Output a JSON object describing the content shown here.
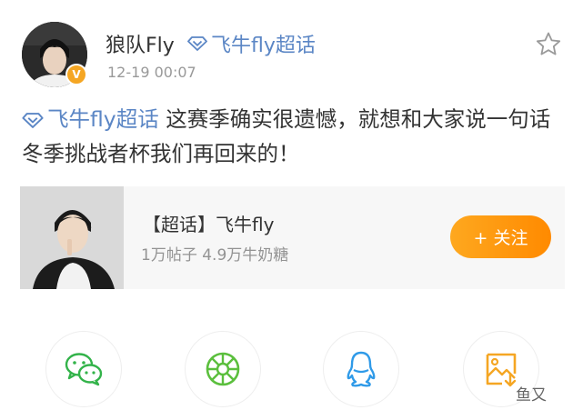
{
  "header": {
    "username": "狼队Fly",
    "topic_label": "飞牛fly超话",
    "timestamp": "12-19 00:07"
  },
  "post": {
    "topic_label": "飞牛fly超话",
    "text": "这赛季确实很遗憾，就想和大家说一句话冬季挑战者杯我们再回来的！"
  },
  "card": {
    "title": "【超话】飞牛fly",
    "stats": "1万帖子 4.9万牛奶糖",
    "follow_label": "+ 关注"
  },
  "share": [
    {
      "icon": "wechat-icon",
      "color": "#33b34a"
    },
    {
      "icon": "moments-icon",
      "color": "#5bbf3d"
    },
    {
      "icon": "qq-icon",
      "color": "#2f9ae8"
    },
    {
      "icon": "save-image-icon",
      "color": "#f5a623"
    }
  ],
  "watermark": "鱼又",
  "colors": {
    "link": "#5b86c5",
    "follow_button": "#ff9a14",
    "timestamp": "#999999"
  }
}
